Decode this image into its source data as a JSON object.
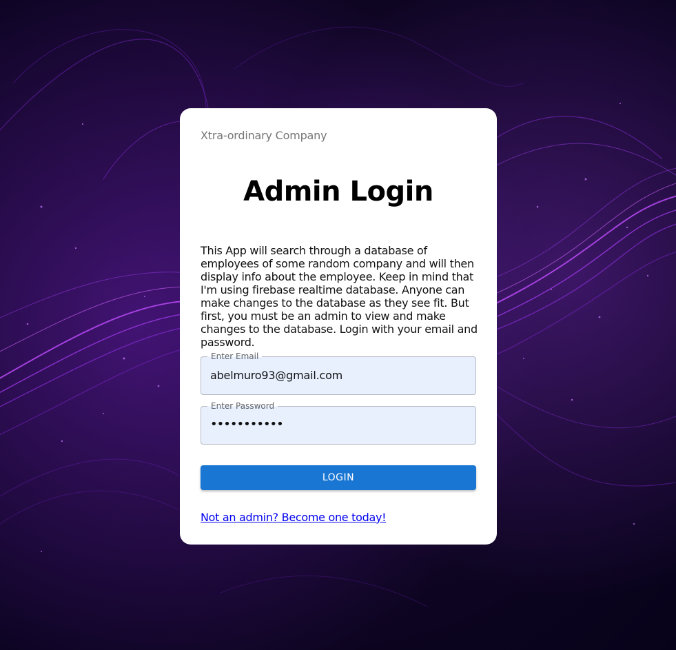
{
  "background": {
    "base_color": "#0b0420",
    "accent_color": "#b042ff"
  },
  "card": {
    "company": "Xtra-ordinary Company",
    "title": "Admin Login",
    "description": "This App will search through a database of employees of some random company and will then display info about the employee. Keep in mind that I'm using firebase realtime database. Anyone can make changes to the database as they see fit. But first, you must be an admin to view and make changes to the database. Login with your email and password.",
    "email_field": {
      "label": "Enter Email",
      "value": "abelmuro93@gmail.com"
    },
    "password_field": {
      "label": "Enter Password",
      "value": "•••••••••••"
    },
    "login_button": "LOGIN",
    "signup_link": "Not an admin? Become one today!"
  },
  "colors": {
    "primary": "#1976d2",
    "link": "#0000ee",
    "autofill_bg": "#e8f0fe"
  }
}
